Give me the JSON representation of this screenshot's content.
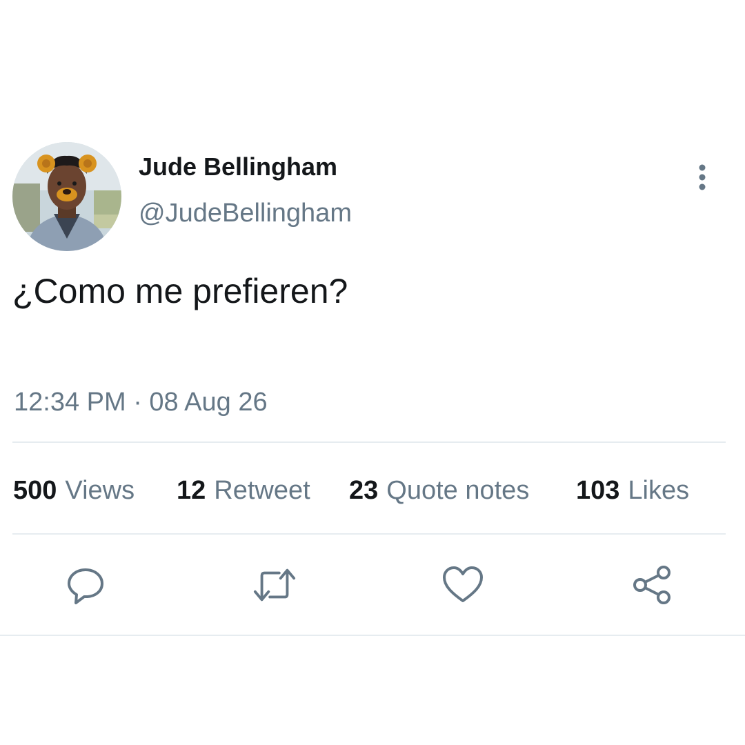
{
  "user": {
    "display_name": "Jude Bellingham",
    "handle": "@JudeBellingham"
  },
  "tweet": {
    "text": "¿Como me prefieren?",
    "timestamp": "12:34 PM · 08 Aug 26"
  },
  "stats": [
    {
      "count": "500",
      "label": "Views"
    },
    {
      "count": "12",
      "label": "Retweet"
    },
    {
      "count": "23",
      "label": "Quote notes"
    },
    {
      "count": "103",
      "label": "Likes"
    }
  ],
  "actions": [
    "reply-icon",
    "retweet-icon",
    "like-icon",
    "share-icon"
  ],
  "colors": {
    "text_primary": "#14171a",
    "text_secondary": "#657786",
    "divider": "#e6ecf0"
  }
}
